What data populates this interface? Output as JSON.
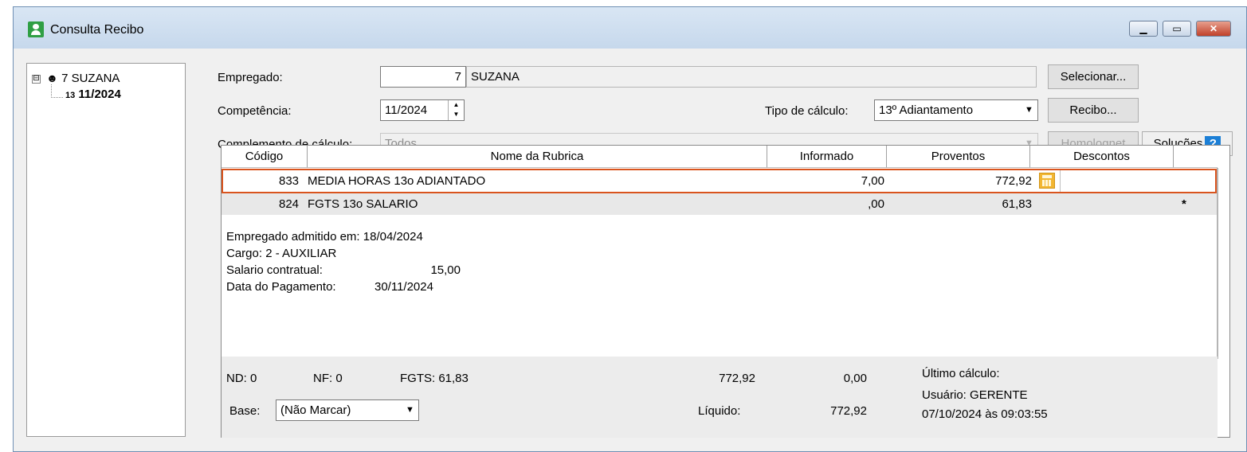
{
  "window": {
    "title": "Consulta Recibo",
    "controls": [
      "minimize",
      "maximize",
      "close"
    ]
  },
  "tree": {
    "root": {
      "expander": "⊟",
      "label": "7 SUZANA"
    },
    "child": {
      "label": "11/2024"
    }
  },
  "form": {
    "empregado_label": "Empregado:",
    "empregado_code": "7",
    "empregado_name": "SUZANA",
    "competencia_label": "Competência:",
    "competencia_value": "11/2024",
    "tipo_calculo_label": "Tipo de cálculo:",
    "tipo_calculo_value": "13º Adiantamento",
    "complemento_label": "Complemento de cálculo:",
    "complemento_value": "Todos"
  },
  "buttons": {
    "selecionar": "Selecionar...",
    "recibo": "Recibo...",
    "homolognet": "Homolognet",
    "solucoes": "Soluções",
    "help": "?"
  },
  "grid": {
    "headers": [
      "Código",
      "Nome da Rubrica",
      "Informado",
      "Proventos",
      "Descontos"
    ],
    "rows": [
      {
        "codigo": "833",
        "nome": "MEDIA HORAS 13o ADIANTADO",
        "informado": "7,00",
        "proventos": "772,92",
        "descontos": "",
        "mark": ""
      },
      {
        "codigo": "824",
        "nome": "FGTS 13o SALARIO",
        "informado": ",00",
        "proventos": "61,83",
        "descontos": "",
        "mark": "*"
      }
    ]
  },
  "info": {
    "admitido": "Empregado admitido em:  18/04/2024",
    "cargo": "Cargo: 2 - AUXILIAR",
    "salario_label": "Salario contratual:",
    "salario_value": "15,00",
    "pagamento_label": "Data do Pagamento:",
    "pagamento_value": "30/11/2024"
  },
  "footer": {
    "nd": "ND:  0",
    "nf": "NF:  0",
    "fgts": "FGTS:  61,83",
    "total_proventos": "772,92",
    "total_descontos": "0,00",
    "ultimo_calculo": "Último cálculo:",
    "usuario": "Usuário: GERENTE",
    "data_calculo": "07/10/2024 às 09:03:55",
    "base_label": "Base:",
    "base_value": "(Não Marcar)",
    "liquido_label": "Líquido:",
    "liquido_value": "772,92"
  }
}
